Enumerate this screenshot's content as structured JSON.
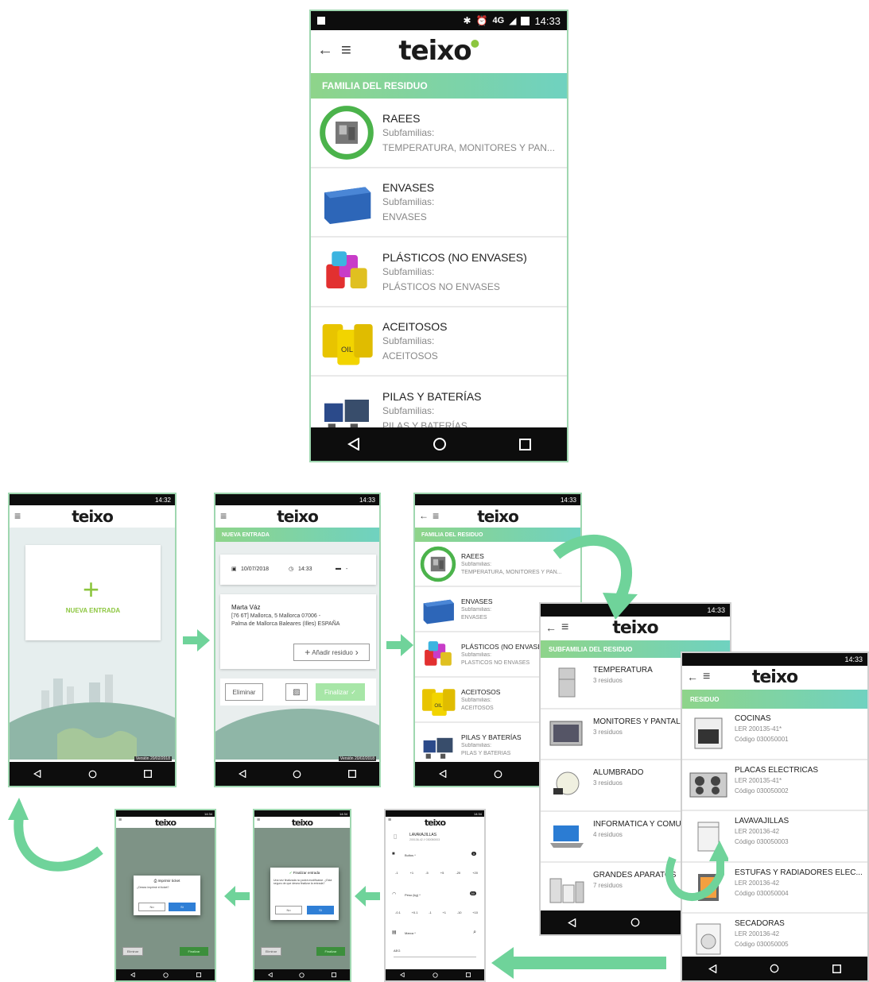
{
  "statusbar": {
    "time_main": "14:33",
    "time_home": "14:32",
    "time_small": "14:33",
    "time_dialog": "14:34",
    "signal": "4G"
  },
  "logo": "teixo",
  "familia_screen": {
    "title": "FAMILIA DEL RESIDUO",
    "items": [
      {
        "name": "RAEES",
        "sub_label": "Subfamilias:",
        "sub": "TEMPERATURA, MONITORES Y PAN...",
        "icon": "raees-recycle-icon"
      },
      {
        "name": "ENVASES",
        "sub_label": "Subfamilias:",
        "sub": "ENVASES",
        "icon": "blue-crate-icon"
      },
      {
        "name": "PLÁSTICOS (NO ENVASES)",
        "sub_label": "Subfamilias:",
        "sub": "PLÁSTICOS NO ENVASES",
        "icon": "plastic-cups-icon"
      },
      {
        "name": "ACEITOSOS",
        "sub_label": "Subfamilias:",
        "sub": "ACEITOSOS",
        "icon": "oil-barrel-icon"
      },
      {
        "name": "PILAS Y BATERÍAS",
        "sub_label": "Subfamilias:",
        "sub": "PILAS Y BATERÍAS",
        "icon": "battery-icon"
      }
    ]
  },
  "home_screen": {
    "new_entry": "NUEVA ENTRADA",
    "version": "Versión 20/02/2018"
  },
  "entrada_screen": {
    "title": "NUEVA ENTRADA",
    "date": "10/07/2018",
    "time": "14:33",
    "vehicle": "-",
    "name": "Marta Váz",
    "address_line1": "[76        6T] Mallorca, 5 Mallorca 07006 -",
    "address_line2": "Palma de Mallorca Baleares (Illes) ESPAÑA",
    "add_residuo": "Añadir residuo",
    "delete": "Eliminar",
    "finish": "Finalizar",
    "version": "Versión 20/02/2018"
  },
  "familia_small": {
    "title": "FAMILIA DEL RESIDUO",
    "items": [
      {
        "name": "RAEES",
        "sub_label": "Subfamilias:",
        "sub": "TEMPERATURA, MONITORES Y PAN..."
      },
      {
        "name": "ENVASES",
        "sub_label": "Subfamilias:",
        "sub": "ENVASES"
      },
      {
        "name": "PLÁSTICOS (NO ENVASES)",
        "sub_label": "Subfamilias:",
        "sub": "PLÁSTICOS NO ENVASES"
      },
      {
        "name": "ACEITOSOS",
        "sub_label": "Subfamilias:",
        "sub": "ACEITOSOS"
      },
      {
        "name": "PILAS Y BATERÍAS",
        "sub_label": "Subfamilias:",
        "sub": "PILAS Y BATERÍAS"
      }
    ]
  },
  "subfamilia_screen": {
    "title": "SUBFAMILIA DEL RESIDUO",
    "items": [
      {
        "name": "TEMPERATURA",
        "count": "3 residuos"
      },
      {
        "name": "MONITORES Y PANTALLAS",
        "count": "3 residuos"
      },
      {
        "name": "ALUMBRADO",
        "count": "3 residuos"
      },
      {
        "name": "INFORMÁTICA Y COMUNICACIONES",
        "count": "4 residuos"
      },
      {
        "name": "GRANDES APARATOS",
        "count": "7 residuos"
      }
    ]
  },
  "residuo_screen": {
    "title": "RESIDUO",
    "items": [
      {
        "name": "COCINAS",
        "ler": "LER 200135-41*",
        "code": "Código 030050001"
      },
      {
        "name": "PLACAS ELÉCTRICAS",
        "ler": "LER 200135-41*",
        "code": "Código 030050002"
      },
      {
        "name": "LAVAVAJILLAS",
        "ler": "LER 200136-42",
        "code": "Código 030050003"
      },
      {
        "name": "ESTUFAS Y RADIADORES ELÉC...",
        "ler": "LER 200136-42",
        "code": "Código 030050004"
      },
      {
        "name": "SECADORAS",
        "ler": "LER 200136-42",
        "code": "Código 030050005"
      }
    ]
  },
  "bottom_screens": {
    "print_dialog": {
      "title": "Imprimir ticket",
      "question": "¿Desea imprimir el ticket?",
      "no": "No",
      "yes": "Sí"
    },
    "finish_dialog": {
      "title": "Finalizar entrada",
      "text": "Una vez finalizada no podrá modificarse. ¿Está seguro de que desea finalizar la entrada?",
      "no": "No",
      "yes": "Sí"
    },
    "form": {
      "item_name": "LAVAVAJILLAS",
      "item_code": "200136-42 // 030050003",
      "bultos_label": "Bultos *",
      "bultos_value": "0",
      "bultos_steps": [
        "-1",
        "+1",
        "-5",
        "+5",
        "-20",
        "+20"
      ],
      "peso_label": "Peso (kg) *",
      "peso_value": "50",
      "peso_steps": [
        "-0.1",
        "+0.1",
        "-1",
        "+1",
        "-10",
        "+10"
      ],
      "marca_label": "Marca *",
      "marca_value": "AEG"
    },
    "add_residuo": "Añadir residuo",
    "delete": "Eliminar",
    "finish": "Finalizar"
  },
  "colors": {
    "accent_green": "#8cc63f",
    "flow_arrow": "#6fd39a",
    "section_gradient_start": "#8ed48a",
    "section_gradient_end": "#6fd2c0"
  }
}
